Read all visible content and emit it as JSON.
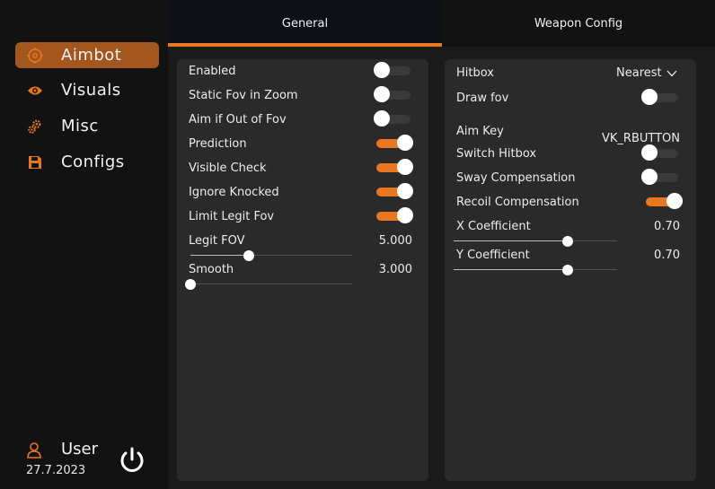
{
  "sidebar": {
    "items": [
      {
        "label": "Aimbot",
        "icon": "crosshair-icon",
        "active": true
      },
      {
        "label": "Visuals",
        "icon": "eye-icon",
        "active": false
      },
      {
        "label": "Misc",
        "icon": "gears-icon",
        "active": false
      },
      {
        "label": "Configs",
        "icon": "floppy-disk-icon",
        "active": false
      }
    ],
    "user": {
      "name": "User",
      "date": "27.7.2023",
      "icon": "user-icon"
    },
    "power_icon": "power-icon"
  },
  "tabs": [
    {
      "label": "General",
      "active": true
    },
    {
      "label": "Weapon Config",
      "active": false
    }
  ],
  "left_panel": {
    "toggles": [
      {
        "label": "Enabled",
        "on": false
      },
      {
        "label": "Static Fov in Zoom",
        "on": false
      },
      {
        "label": "Aim if Out of Fov",
        "on": false
      },
      {
        "label": "Prediction",
        "on": true
      },
      {
        "label": "Visible Check",
        "on": true
      },
      {
        "label": "Ignore Knocked",
        "on": true
      },
      {
        "label": "Limit Legit Fov",
        "on": true
      }
    ],
    "sliders": [
      {
        "label": "Legit FOV",
        "value": "5.000",
        "fraction": 0.36
      },
      {
        "label": "Smooth",
        "value": "3.000",
        "fraction": 0.0
      }
    ]
  },
  "right_panel": {
    "hitbox": {
      "label": "Hitbox",
      "value": "Nearest",
      "icon": "chevron-down-icon"
    },
    "draw_fov": {
      "label": "Draw fov",
      "on": false
    },
    "aim_key": {
      "label": "Aim Key",
      "value": "VK_RBUTTON"
    },
    "switch_hitbox": {
      "label": "Switch Hitbox",
      "on": false
    },
    "sway_compensation": {
      "label": "Sway Compensation",
      "on": false
    },
    "recoil_compensation": {
      "label": "Recoil Compensation",
      "on": true
    },
    "sliders": [
      {
        "label": "X Coefficient",
        "value": "0.70",
        "fraction": 0.7
      },
      {
        "label": "Y Coefficient",
        "value": "0.70",
        "fraction": 0.7
      }
    ]
  },
  "colors": {
    "accent": "#e87722",
    "active_nav": "#a3561d",
    "panel": "#2a2a2a",
    "sidebar": "#121212"
  }
}
